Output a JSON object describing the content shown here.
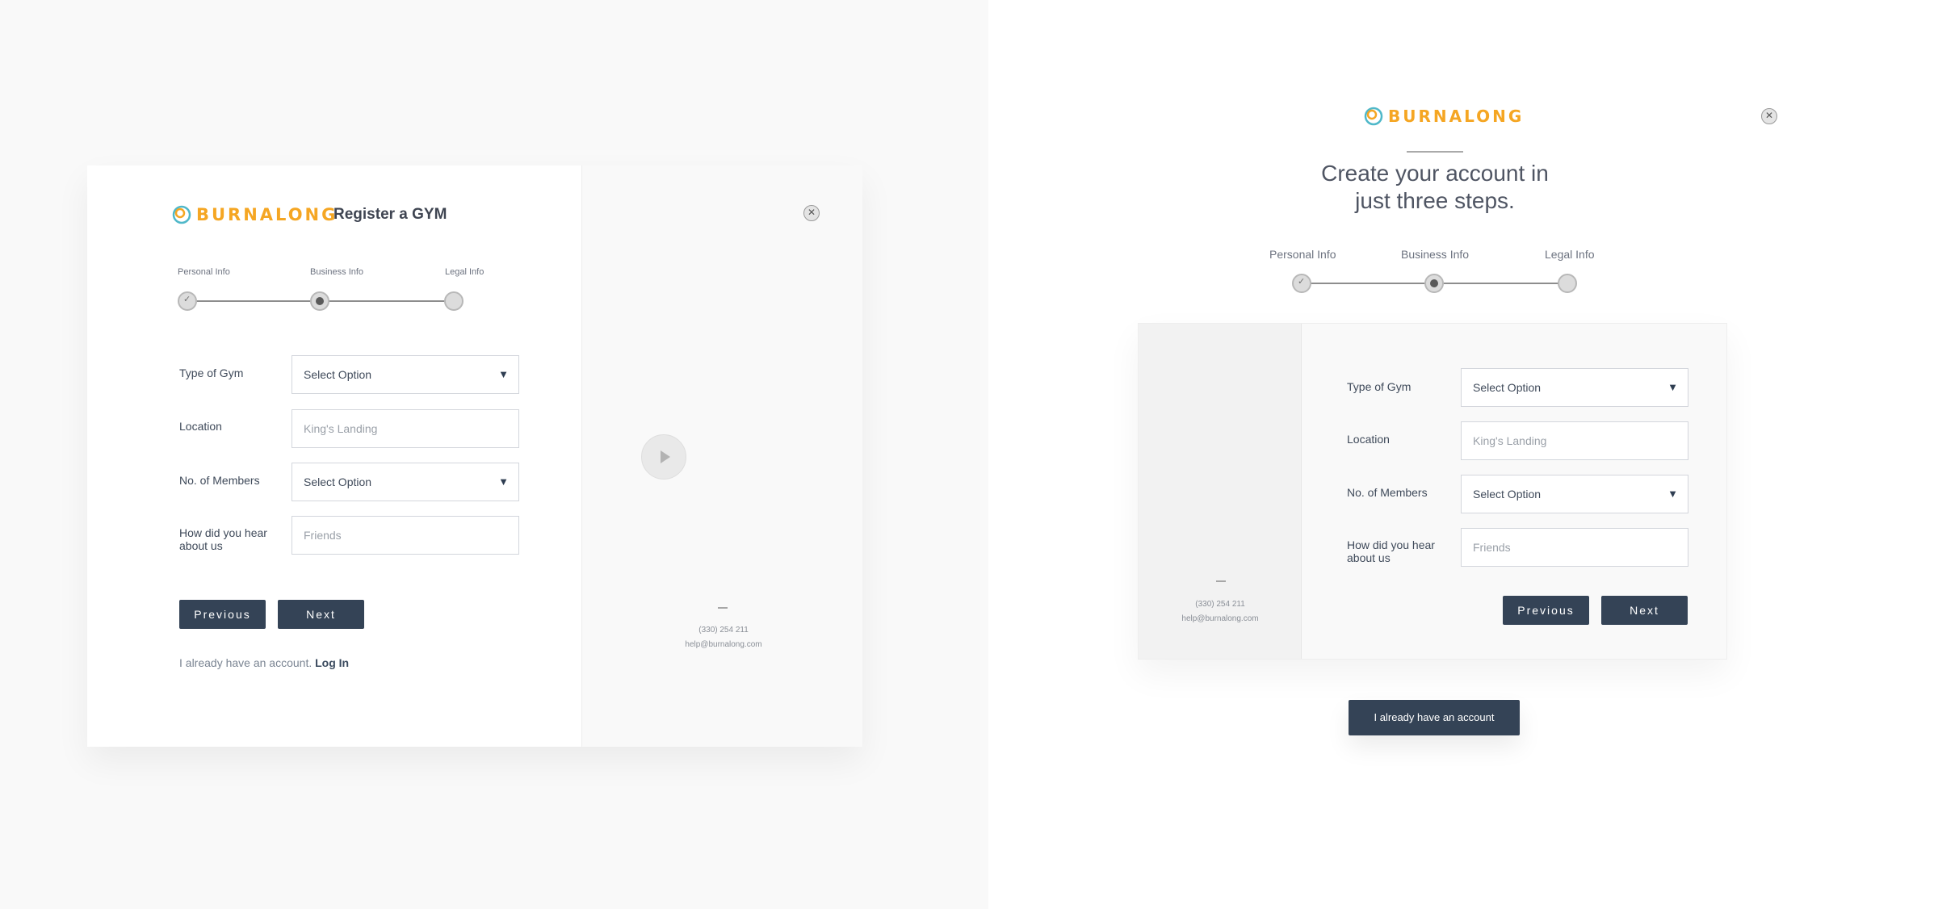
{
  "brand": {
    "name": "BURNALONG",
    "accent": "#f5a623",
    "mark_color": "#4fb8c9"
  },
  "left": {
    "page_title": "Register a GYM",
    "steps": [
      {
        "label": "Personal Info",
        "state": "done"
      },
      {
        "label": "Business Info",
        "state": "current"
      },
      {
        "label": "Legal Info",
        "state": "pending"
      }
    ],
    "form": {
      "type_of_gym": {
        "label": "Type of Gym",
        "value": "Select Option"
      },
      "location": {
        "label": "Location",
        "placeholder": "King's Landing"
      },
      "members": {
        "label": "No. of Members",
        "value": "Select Option"
      },
      "hear": {
        "label_line1": "How did you hear",
        "label_line2": "about us",
        "placeholder": "Friends"
      }
    },
    "buttons": {
      "previous": "Previous",
      "next": "Next"
    },
    "login": {
      "text": "I already have an account.",
      "link": "Log In"
    },
    "contact": {
      "phone": "(330) 254 211",
      "email": "help@burnalong.com"
    },
    "close_icon": "close-icon",
    "play_icon": "play-icon"
  },
  "right": {
    "headline_line1": "Create your account in",
    "headline_line2": "just three steps.",
    "steps": [
      {
        "label": "Personal Info",
        "state": "done"
      },
      {
        "label": "Business Info",
        "state": "current"
      },
      {
        "label": "Legal Info",
        "state": "pending"
      }
    ],
    "form": {
      "type_of_gym": {
        "label": "Type of Gym",
        "value": "Select Option"
      },
      "location": {
        "label": "Location",
        "placeholder": "King's Landing"
      },
      "members": {
        "label": "No. of Members",
        "value": "Select Option"
      },
      "hear": {
        "label_line1": "How did you hear",
        "label_line2": "about us",
        "placeholder": "Friends"
      }
    },
    "buttons": {
      "previous": "Previous",
      "next": "Next"
    },
    "contact": {
      "phone": "(330) 254 211",
      "email": "help@burnalong.com"
    },
    "account_button": "I already have an account"
  }
}
